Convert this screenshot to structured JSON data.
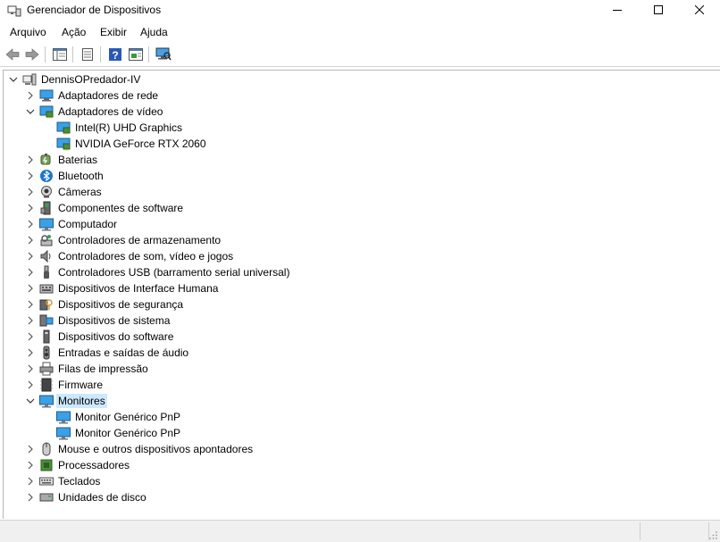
{
  "window": {
    "title": "Gerenciador de Dispositivos"
  },
  "menu": [
    "Arquivo",
    "Ação",
    "Exibir",
    "Ajuda"
  ],
  "toolbar": [
    "back-icon",
    "forward-icon",
    "show-hide-tree-icon",
    "properties-icon",
    "help-icon",
    "update-driver-icon",
    "scan-hardware-icon"
  ],
  "tree": {
    "root": "DennisOPredador-IV",
    "selected": "Monitores",
    "nodes": [
      {
        "label": "Adaptadores de rede",
        "icon": "network-adapter-icon",
        "expanded": false
      },
      {
        "label": "Adaptadores de vídeo",
        "icon": "display-adapter-icon",
        "expanded": true,
        "children": [
          {
            "label": "Intel(R) UHD Graphics",
            "icon": "display-adapter-icon"
          },
          {
            "label": "NVIDIA GeForce RTX 2060",
            "icon": "display-adapter-icon"
          }
        ]
      },
      {
        "label": "Baterias",
        "icon": "battery-icon",
        "expanded": false
      },
      {
        "label": "Bluetooth",
        "icon": "bluetooth-icon",
        "expanded": false
      },
      {
        "label": "Câmeras",
        "icon": "camera-icon",
        "expanded": false
      },
      {
        "label": "Componentes de software",
        "icon": "software-component-icon",
        "expanded": false
      },
      {
        "label": "Computador",
        "icon": "computer-icon",
        "expanded": false
      },
      {
        "label": "Controladores de armazenamento",
        "icon": "storage-controller-icon",
        "expanded": false
      },
      {
        "label": "Controladores de som, vídeo e jogos",
        "icon": "sound-icon",
        "expanded": false
      },
      {
        "label": "Controladores USB (barramento serial universal)",
        "icon": "usb-icon",
        "expanded": false
      },
      {
        "label": "Dispositivos de Interface Humana",
        "icon": "hid-icon",
        "expanded": false
      },
      {
        "label": "Dispositivos de segurança",
        "icon": "security-device-icon",
        "expanded": false
      },
      {
        "label": "Dispositivos de sistema",
        "icon": "system-device-icon",
        "expanded": false
      },
      {
        "label": "Dispositivos do software",
        "icon": "software-device-icon",
        "expanded": false
      },
      {
        "label": "Entradas e saídas de áudio",
        "icon": "audio-io-icon",
        "expanded": false
      },
      {
        "label": "Filas de impressão",
        "icon": "print-queue-icon",
        "expanded": false
      },
      {
        "label": "Firmware",
        "icon": "firmware-icon",
        "expanded": false
      },
      {
        "label": "Monitores",
        "icon": "monitor-icon",
        "expanded": true,
        "children": [
          {
            "label": "Monitor Genérico PnP",
            "icon": "monitor-icon"
          },
          {
            "label": "Monitor Genérico PnP",
            "icon": "monitor-icon"
          }
        ]
      },
      {
        "label": "Mouse e outros dispositivos apontadores",
        "icon": "mouse-icon",
        "expanded": false
      },
      {
        "label": "Processadores",
        "icon": "processor-icon",
        "expanded": false
      },
      {
        "label": "Teclados",
        "icon": "keyboard-icon",
        "expanded": false
      },
      {
        "label": "Unidades de disco",
        "icon": "disk-drive-icon",
        "expanded": false
      }
    ]
  },
  "colors": {
    "selection": "#cce8ff",
    "monitor_blue": "#1e8fd6",
    "window_bg": "#ffffff"
  }
}
